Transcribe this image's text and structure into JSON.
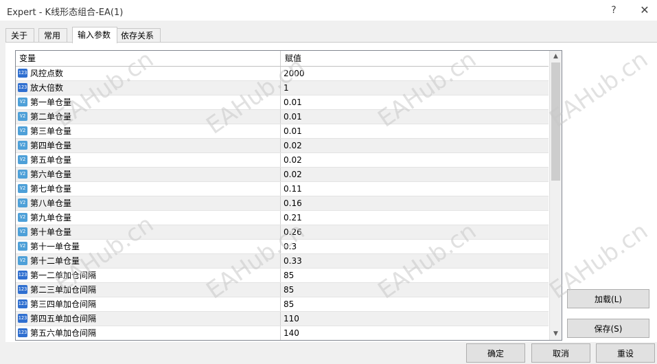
{
  "window": {
    "title": "Expert - K线形态组合-EA(1)",
    "help_glyph": "?",
    "close_glyph": "✕"
  },
  "tabs": [
    {
      "label": "关于"
    },
    {
      "label": "常用"
    },
    {
      "label": "输入参数"
    },
    {
      "label": "依存关系"
    }
  ],
  "table": {
    "columns": [
      "变量",
      "赋值"
    ],
    "rows": [
      {
        "type": "int",
        "icon": "123",
        "name": "风控点数",
        "value": "2000"
      },
      {
        "type": "int",
        "icon": "123",
        "name": "放大倍数",
        "value": "1"
      },
      {
        "type": "double",
        "icon": "V2",
        "name": "第一单仓量",
        "value": "0.01"
      },
      {
        "type": "double",
        "icon": "V2",
        "name": "第二单仓量",
        "value": "0.01"
      },
      {
        "type": "double",
        "icon": "V2",
        "name": "第三单仓量",
        "value": "0.01"
      },
      {
        "type": "double",
        "icon": "V2",
        "name": "第四单仓量",
        "value": "0.02"
      },
      {
        "type": "double",
        "icon": "V2",
        "name": "第五单仓量",
        "value": "0.02"
      },
      {
        "type": "double",
        "icon": "V2",
        "name": "第六单仓量",
        "value": "0.02"
      },
      {
        "type": "double",
        "icon": "V2",
        "name": "第七单仓量",
        "value": "0.11"
      },
      {
        "type": "double",
        "icon": "V2",
        "name": "第八单仓量",
        "value": "0.16"
      },
      {
        "type": "double",
        "icon": "V2",
        "name": "第九单仓量",
        "value": "0.21"
      },
      {
        "type": "double",
        "icon": "V2",
        "name": "第十单仓量",
        "value": "0.26"
      },
      {
        "type": "double",
        "icon": "V2",
        "name": "第十一单仓量",
        "value": "0.3"
      },
      {
        "type": "double",
        "icon": "V2",
        "name": "第十二单仓量",
        "value": "0.33"
      },
      {
        "type": "int",
        "icon": "123",
        "name": "第一二单加仓间隔",
        "value": "85"
      },
      {
        "type": "int",
        "icon": "123",
        "name": "第二三单加仓间隔",
        "value": "85"
      },
      {
        "type": "int",
        "icon": "123",
        "name": "第三四单加仓间隔",
        "value": "85"
      },
      {
        "type": "int",
        "icon": "123",
        "name": "第四五单加仓间隔",
        "value": "110"
      },
      {
        "type": "int",
        "icon": "123",
        "name": "第五六单加仓间隔",
        "value": "140"
      }
    ]
  },
  "side_buttons": {
    "load": "加载(L)",
    "save": "保存(S)"
  },
  "bottom_buttons": {
    "ok": "确定",
    "cancel": "取消",
    "reset": "重设"
  },
  "scrollbar": {
    "up_glyph": "▲",
    "down_glyph": "▼"
  },
  "watermark": "EAHub.cn"
}
